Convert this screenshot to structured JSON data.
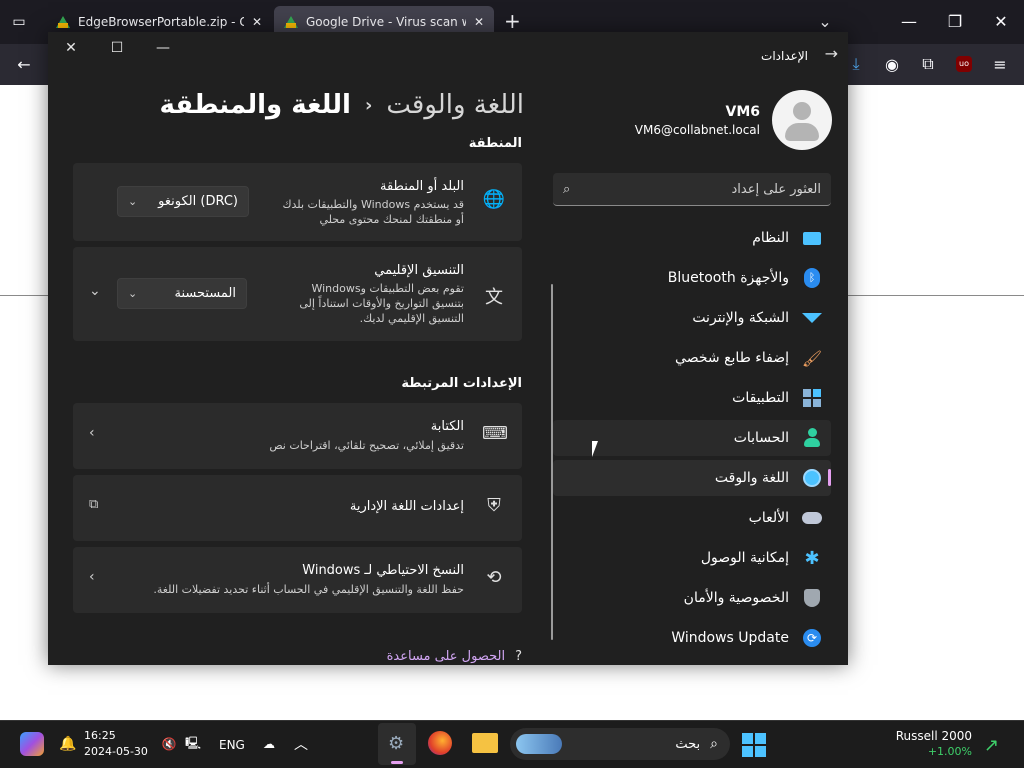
{
  "browser": {
    "tabs": [
      {
        "title": "EdgeBrowserPortable.zip - Goo"
      },
      {
        "title": "Google Drive - Virus scan warni"
      }
    ],
    "new_tab": "+",
    "ext_badge": "uo"
  },
  "window": {
    "title": "الإعدادات"
  },
  "user": {
    "name": "VM6",
    "email": "VM6@collabnet.local"
  },
  "search": {
    "placeholder": "العثور على إعداد"
  },
  "sidebar": {
    "items": [
      {
        "label": "النظام",
        "icon": "monitor-icon",
        "color": "#4cc2ff"
      },
      {
        "label": "Bluetooth والأجهزة",
        "icon": "bluetooth-icon",
        "color": "#2a8cf0"
      },
      {
        "label": "الشبكة والإنترنت",
        "icon": "wifi-icon",
        "color": "#4cc2ff"
      },
      {
        "label": "إضفاء طابع شخصي",
        "icon": "brush-icon",
        "color": "#f0a060"
      },
      {
        "label": "التطبيقات",
        "icon": "apps-icon",
        "color": "#8ab4d8"
      },
      {
        "label": "الحسابات",
        "icon": "person-icon",
        "color": "#2fd0a0"
      },
      {
        "label": "اللغة والوقت",
        "icon": "globe-clock-icon",
        "color": "#4cc2ff"
      },
      {
        "label": "الألعاب",
        "icon": "gamepad-icon",
        "color": "#c0c8d8"
      },
      {
        "label": "إمكانية الوصول",
        "icon": "accessibility-icon",
        "color": "#4cc2ff"
      },
      {
        "label": "الخصوصية والأمان",
        "icon": "shield-icon",
        "color": "#a0a8b0"
      },
      {
        "label": "Windows Update",
        "icon": "update-icon",
        "color": "#2a8cf0"
      }
    ]
  },
  "breadcrumb": {
    "parent": "اللغة والوقت",
    "current": "اللغة والمنطقة"
  },
  "region": {
    "header": "المنطقة",
    "country": {
      "title": "البلد أو المنطقة",
      "desc_line1": "قد يستخدم Windows والتطبيقات بلدك",
      "desc_line2": "أو منطقتك لمنحك محتوى محلي",
      "value": "الكونغو (DRC)"
    },
    "format": {
      "title": "التنسيق الإقليمي",
      "desc_line1": "تقوم بعض التطبيقات وWindows",
      "desc_line2": "بتنسيق التواريخ والأوقات استناداً إلى",
      "desc_line3": "التنسيق الإقليمي لديك.",
      "value": "المستحسنة"
    }
  },
  "related": {
    "header": "الإعدادات المرتبطة",
    "typing": {
      "title": "الكتابة",
      "desc": "تدقيق إملائي، تصحيح تلقائي، اقتراحات نص"
    },
    "admin": {
      "title": "إعدادات اللغة الإدارية"
    },
    "backup": {
      "title": "النسخ الاحتياطي لـ Windows",
      "desc": "حفظ اللغة والتنسيق الإقليمي في الحساب أثناء تحديد تفضيلات اللغة."
    }
  },
  "help": {
    "label": "الحصول على مساعدة"
  },
  "taskbar": {
    "time": "16:25",
    "date": "2024-05-30",
    "lang": "ENG",
    "search_label": "بحث",
    "stock_name": "Russell 2000",
    "stock_change": "+1.00%",
    "stock_color": "#3ecf6a"
  }
}
